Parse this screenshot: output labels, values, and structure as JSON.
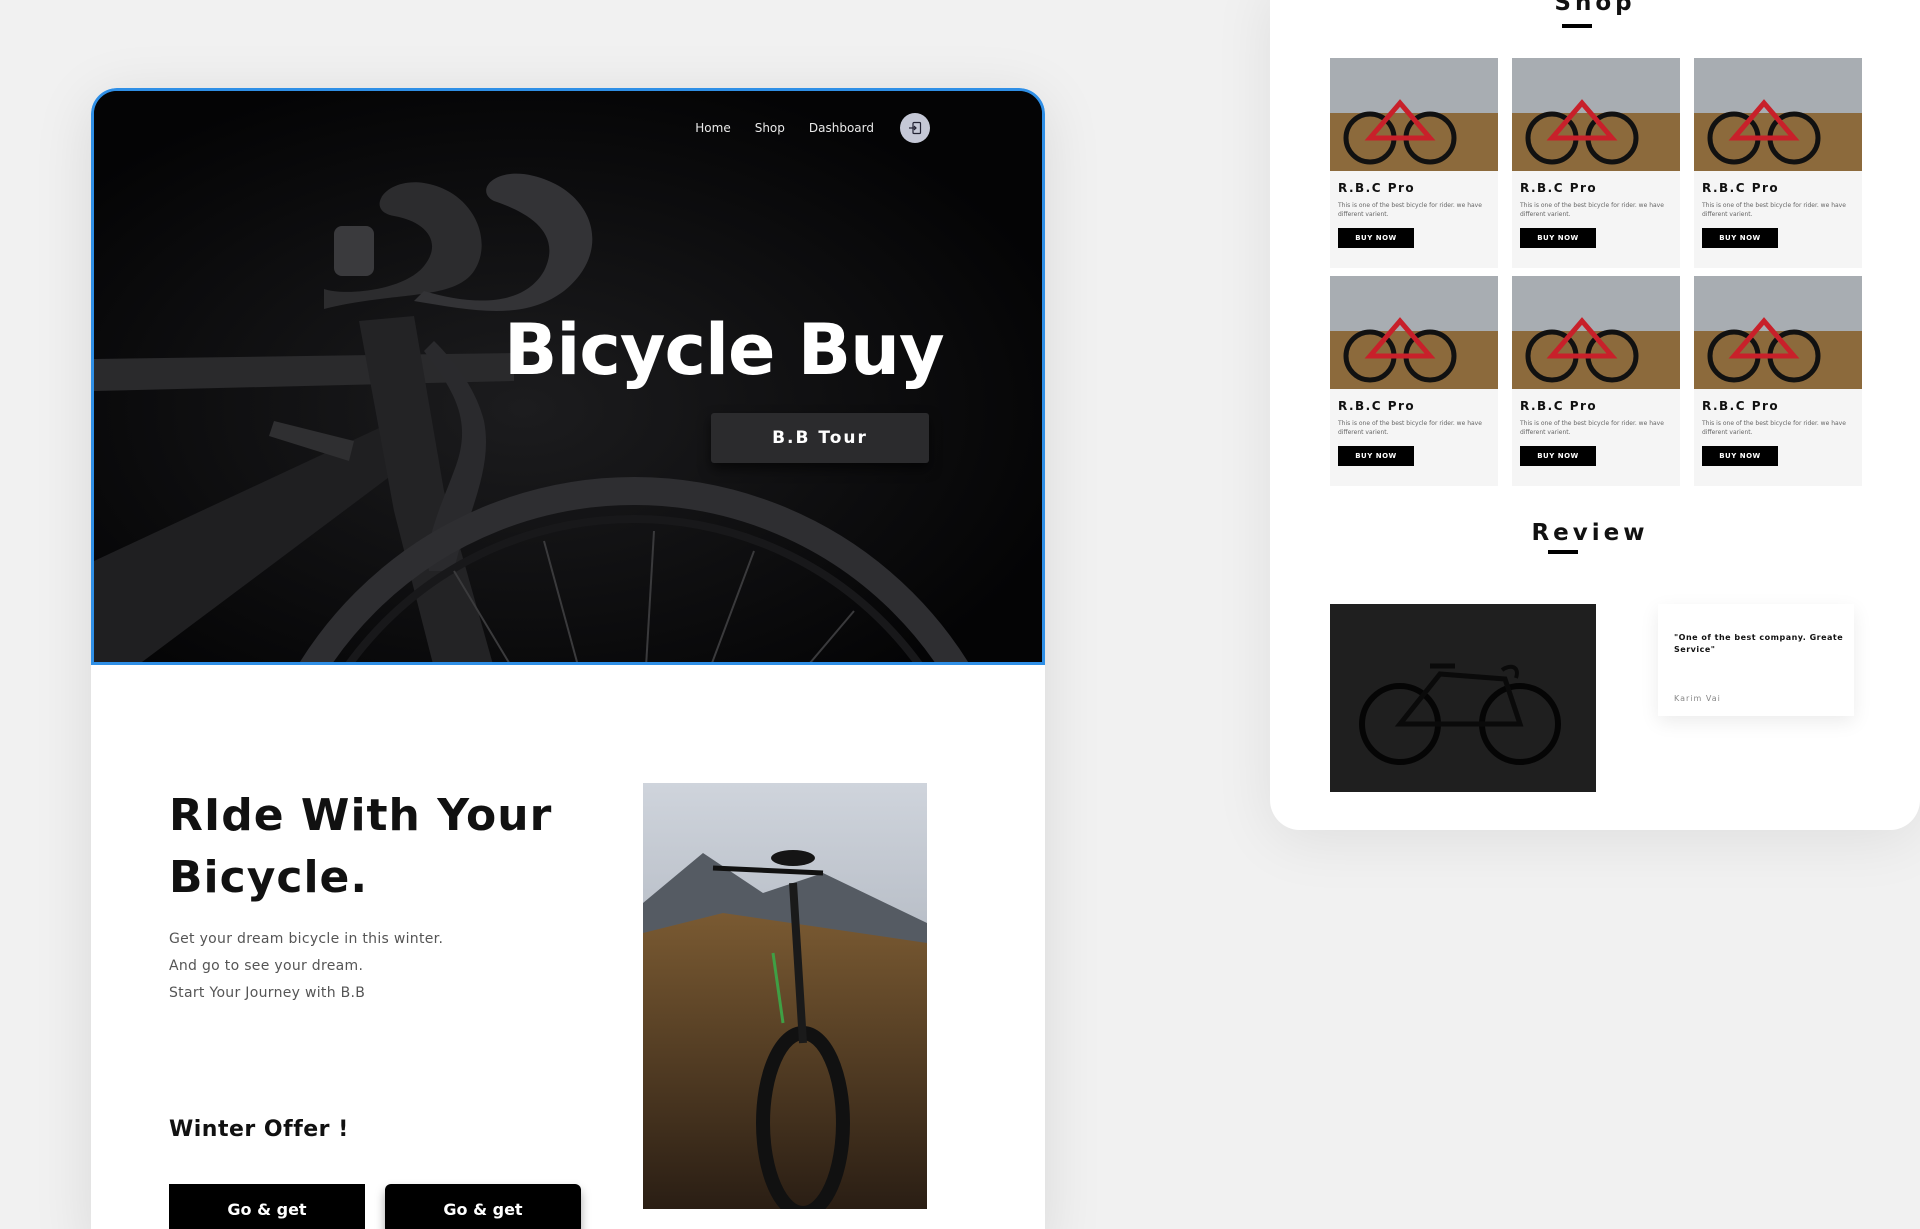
{
  "nav": {
    "items": [
      {
        "label": "Home"
      },
      {
        "label": "Shop"
      },
      {
        "label": "Dashboard"
      }
    ],
    "login_icon": "login-arrow-icon"
  },
  "hero": {
    "title": "Bicycle Buy",
    "tour_button": "B.B Tour"
  },
  "intro": {
    "title_line1": "RIde With Your",
    "title_line2": "Bicycle.",
    "lines": [
      "Get your dream bicycle in this  winter.",
      "And go to see your dream.",
      "Start Your Journey with B.B"
    ],
    "offer": "Winter Offer !",
    "button1": "Go & get",
    "button2": "Go & get"
  },
  "shop": {
    "title": "Shop",
    "products": [
      {
        "name": "R.B.C Pro",
        "desc": "This is one of the best bicycle for rider. we have different varient.",
        "button": "BUY NOW"
      },
      {
        "name": "R.B.C Pro",
        "desc": "This is one of the best bicycle for rider. we have different varient.",
        "button": "BUY NOW"
      },
      {
        "name": "R.B.C Pro",
        "desc": "This is one of the best bicycle for rider. we have different varient.",
        "button": "BUY NOW"
      },
      {
        "name": "R.B.C Pro",
        "desc": "This is one of the best bicycle for rider. we have different varient.",
        "button": "BUY NOW"
      },
      {
        "name": "R.B.C Pro",
        "desc": "This is one of the best bicycle for rider. we have different varient.",
        "button": "BUY NOW"
      },
      {
        "name": "R.B.C Pro",
        "desc": "This is one of the best bicycle for rider. we have different varient.",
        "button": "BUY NOW"
      }
    ]
  },
  "review": {
    "title": "Review",
    "quote": "\"One of the best company. Greate Service\"",
    "author": "Karim Vai"
  },
  "colors": {
    "hero_bg": "#060607",
    "hero_border": "#2f8fe6",
    "accent": "#000000",
    "page_bg": "#f1f1f1"
  }
}
